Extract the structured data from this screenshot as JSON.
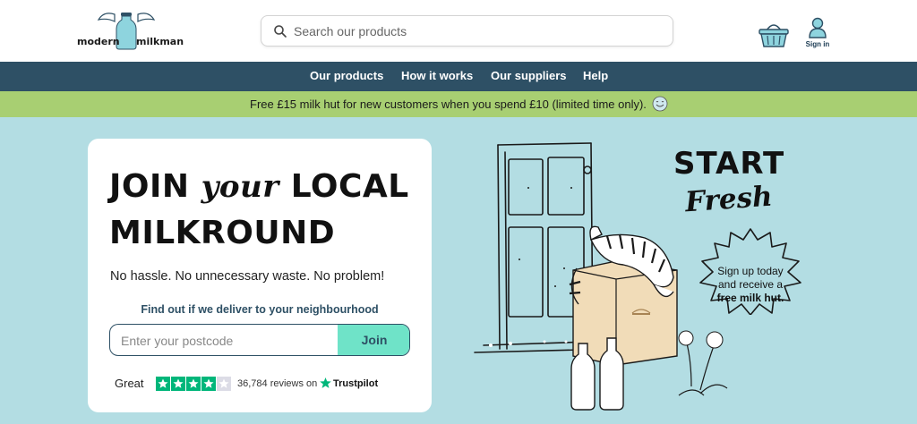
{
  "brand": {
    "logo_left": "modern",
    "logo_right": "milkman"
  },
  "search": {
    "placeholder": "Search our products"
  },
  "header": {
    "account_label": "Sign in"
  },
  "nav": {
    "items": [
      "Our products",
      "How it works",
      "Our suppliers",
      "Help"
    ]
  },
  "promo": {
    "text": "Free £15 milk hut for new customers when you spend £10 (limited time only)."
  },
  "hero_card": {
    "headline_1": "JOIN",
    "headline_your": "your",
    "headline_2": "LOCAL",
    "headline_3": "MILKROUND",
    "tagline": "No hassle. No unnecessary waste. No problem!",
    "find_label": "Find out if we deliver to your neighbourhood",
    "postcode_placeholder": "Enter your postcode",
    "join_label": "Join",
    "rating_word": "Great",
    "stars": 4,
    "reviews": "36,784 reviews on",
    "trustpilot": "Trustpilot"
  },
  "illustration": {
    "start": "START",
    "fresh": "Fresh",
    "badge_line1": "Sign up today",
    "badge_line2": "and receive a",
    "badge_bold": "free milk hut."
  },
  "colors": {
    "nav_bg": "#2e5065",
    "promo_bg": "#a8cf72",
    "page_bg": "#b3dde3",
    "join_bg": "#6fe3c8",
    "trustpilot_green": "#00b67a"
  }
}
